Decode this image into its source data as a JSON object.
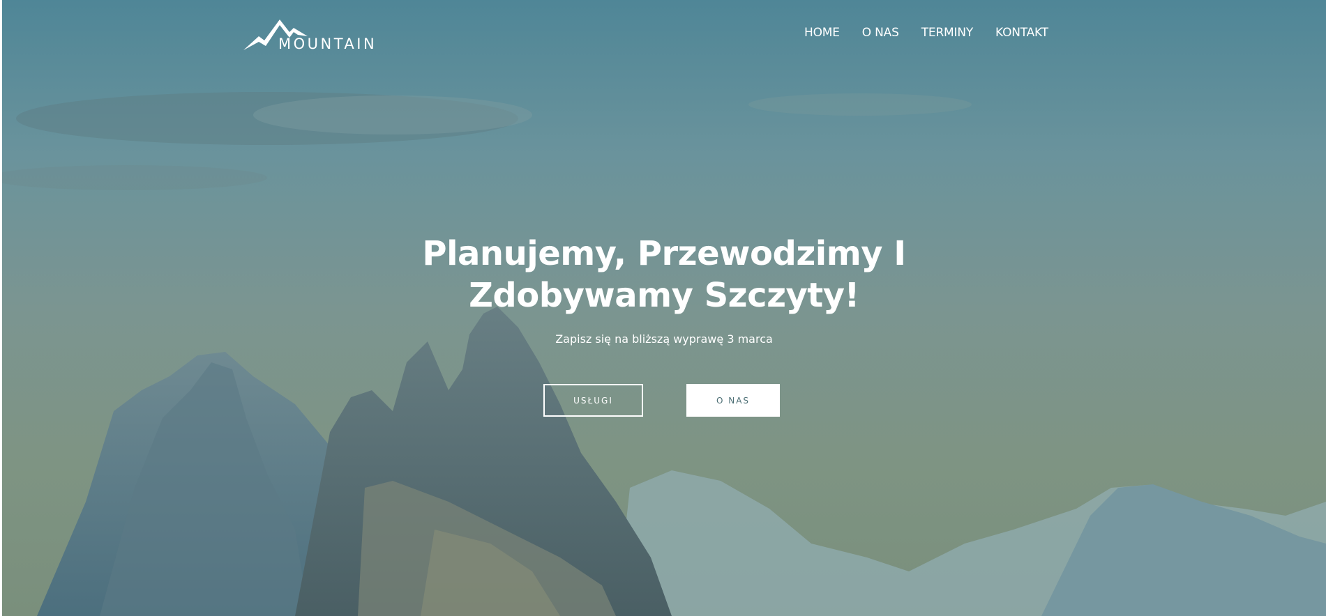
{
  "brand": {
    "logo_text": "MOUNTAIN"
  },
  "nav": {
    "items": [
      {
        "label": "HOME"
      },
      {
        "label": "O NAS"
      },
      {
        "label": "TERMINY"
      },
      {
        "label": "KONTAKT"
      }
    ]
  },
  "hero": {
    "headline_line1": "Planujemy, Przewodzimy I",
    "headline_line2": "Zdobywamy Szczyty!",
    "subheadline": "Zapisz się na bliższą wyprawę 3 marca",
    "buttons": {
      "primary_label": "USŁUGI",
      "secondary_label": "O NAS"
    }
  },
  "colors": {
    "overlay_top": "#4e8596",
    "overlay_bottom": "#7d917e",
    "text": "#ffffff",
    "button_text_dark": "#4b6e74"
  },
  "icons": {
    "logo": "mountain-peaks-icon"
  }
}
